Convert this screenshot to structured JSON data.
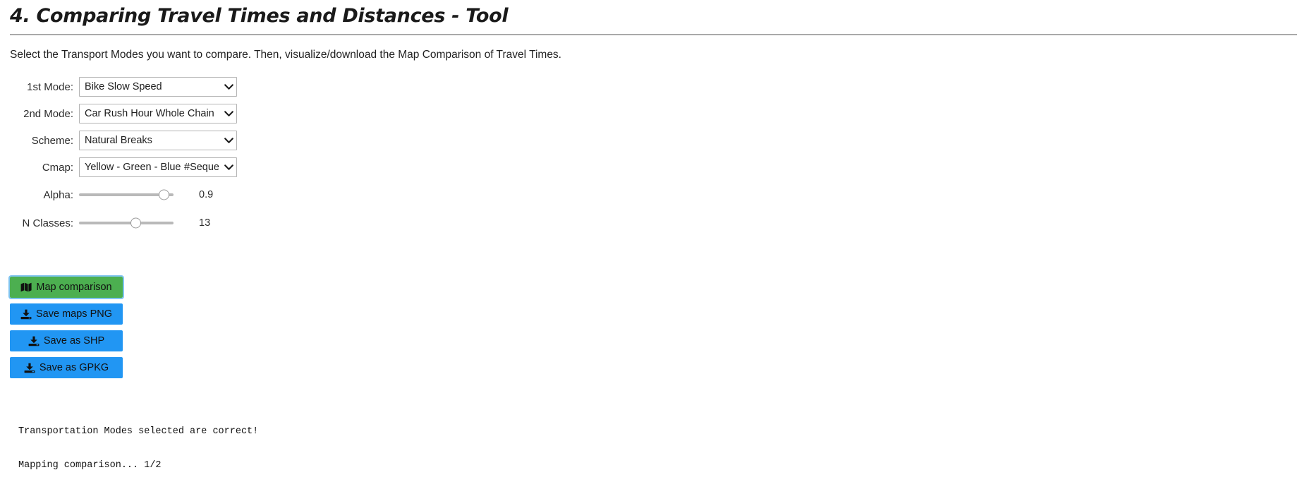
{
  "header": {
    "title": "4. Comparing Travel Times and Distances - Tool",
    "intro": "Select the Transport Modes you want to compare. Then, visualize/download the Map Comparison of Travel Times."
  },
  "form": {
    "fields": [
      {
        "name": "first-mode",
        "label": "1st Mode:",
        "type": "select",
        "value": "Bike Slow Speed",
        "extra": ""
      },
      {
        "name": "second-mode",
        "label": "2nd Mode:",
        "type": "select",
        "value": "Car Rush Hour Whole Chain",
        "extra": ""
      },
      {
        "name": "scheme",
        "label": "Scheme:",
        "type": "select",
        "value": "Natural Breaks",
        "extra": ""
      },
      {
        "name": "cmap",
        "label": "Cmap:",
        "type": "select",
        "value": "Yellow - Green - Blue",
        "extra": "#Seque"
      }
    ],
    "sliders": [
      {
        "name": "alpha",
        "label": "Alpha:",
        "value": "0.9",
        "percent": 90
      },
      {
        "name": "n-classes",
        "label": "N Classes:",
        "value": "13",
        "percent": 60
      }
    ]
  },
  "buttons": [
    {
      "name": "map-comparison-button",
      "label": "Map comparison",
      "icon": "map-icon",
      "style": "green",
      "focused": true
    },
    {
      "name": "save-maps-png-button",
      "label": "Save maps PNG",
      "icon": "download-icon",
      "style": "blue",
      "focused": false
    },
    {
      "name": "save-as-shp-button",
      "label": "Save as SHP",
      "icon": "download-icon",
      "style": "blue",
      "focused": false
    },
    {
      "name": "save-as-gpkg-button",
      "label": "Save as GPKG",
      "icon": "download-icon",
      "style": "blue",
      "focused": false
    }
  ],
  "status": {
    "lines": [
      "Transportation Modes selected are correct!",
      "Mapping comparison... 1/2"
    ]
  },
  "colors": {
    "green_button": "#4caf50",
    "blue_button": "#2196f3",
    "focus_ring": "#7fc4ef",
    "rule": "#a9a9a9",
    "slider_track": "#b9b9b9"
  }
}
